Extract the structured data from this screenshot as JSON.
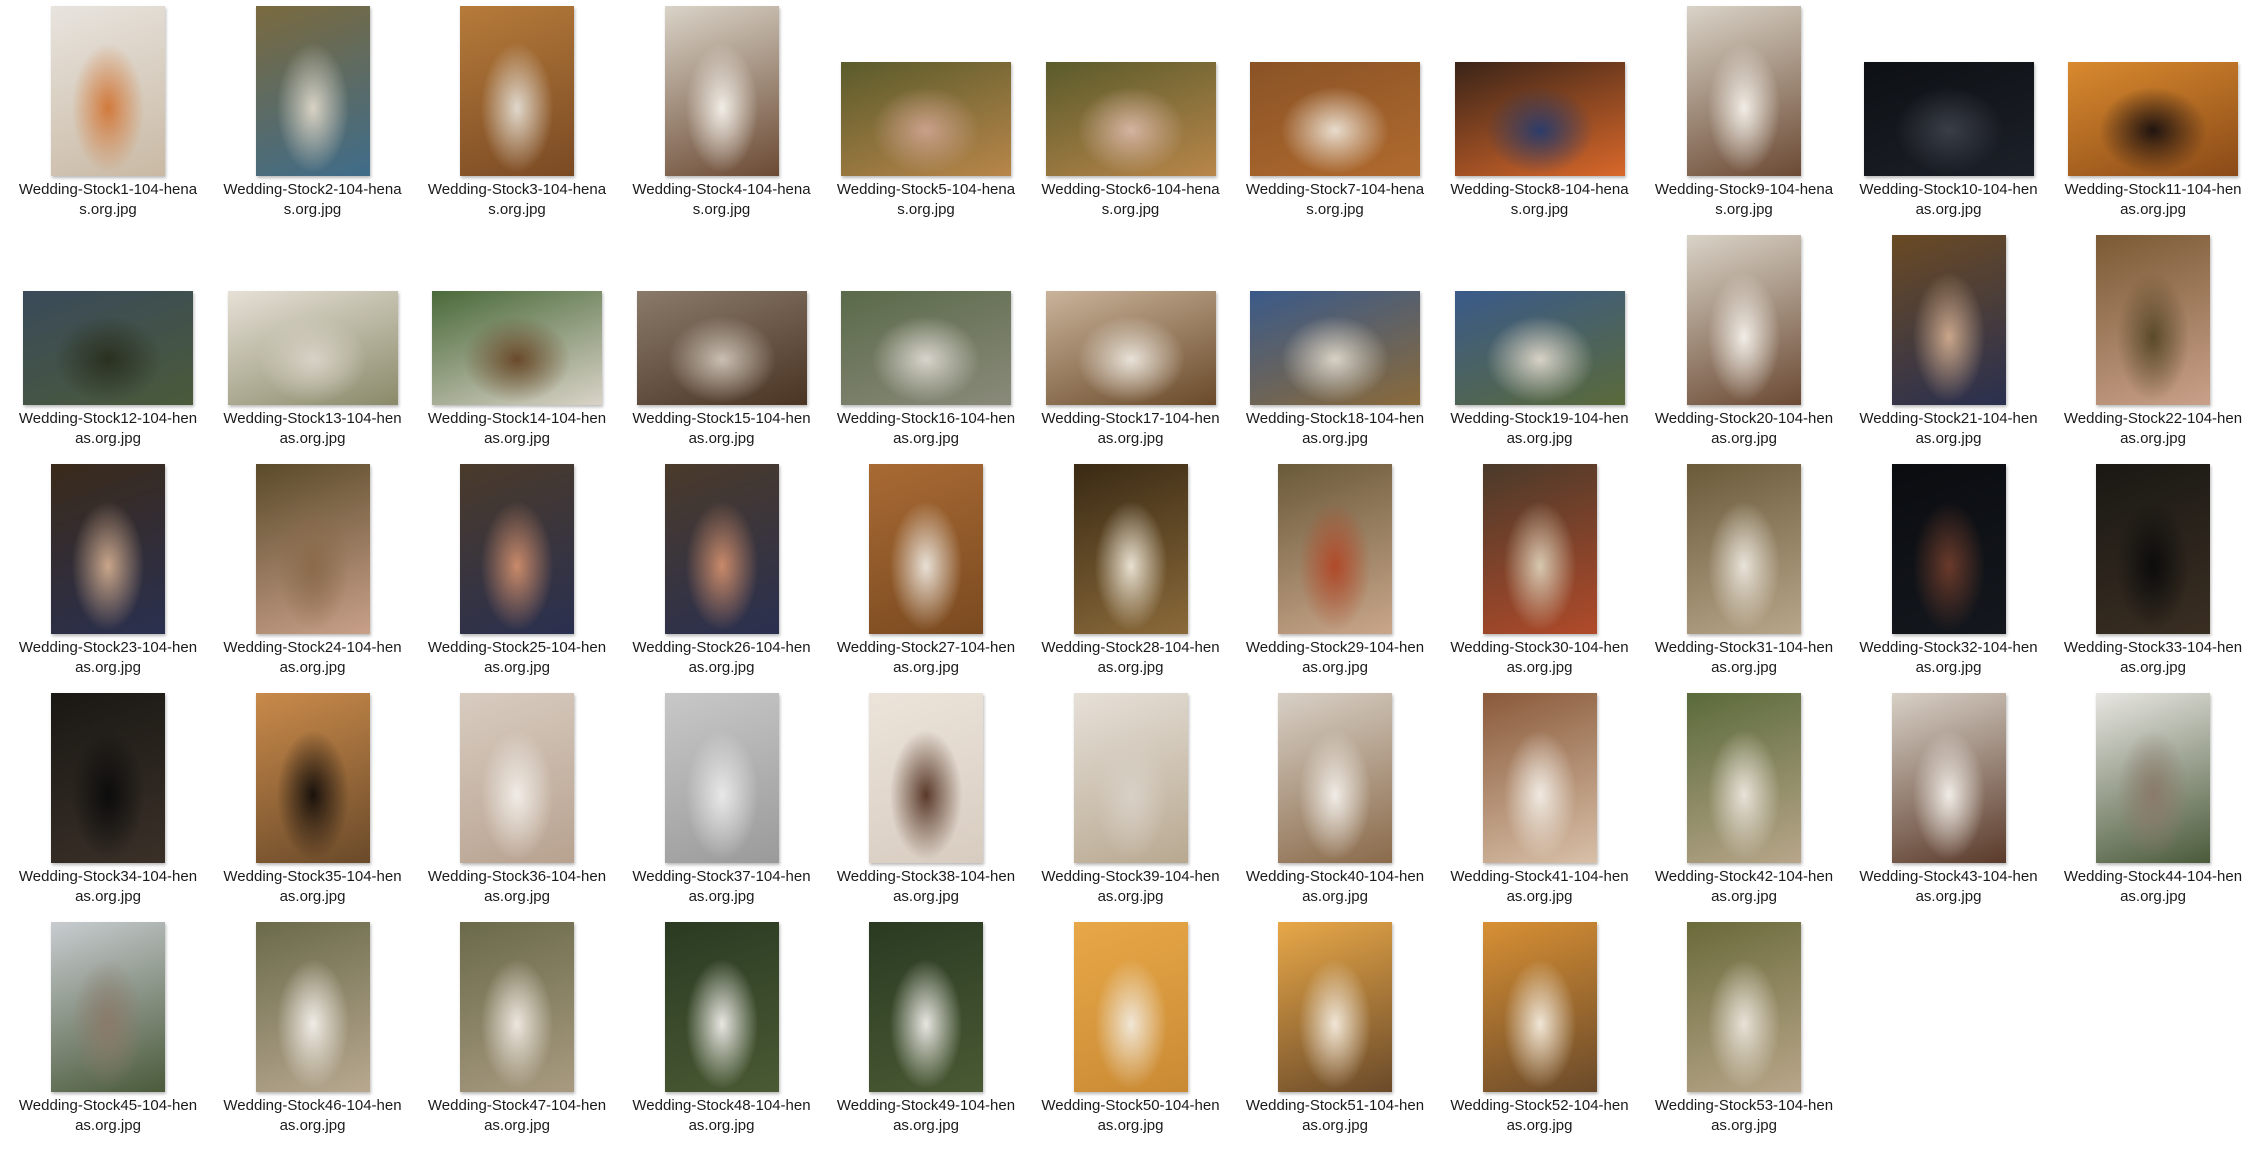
{
  "files": [
    {
      "l1": "Wedding-Stock1-104-hena",
      "l2": "s.org.jpg",
      "o": "p",
      "c": [
        "#e8e4de",
        "#c9b9a4",
        "#d27a3c"
      ]
    },
    {
      "l1": "Wedding-Stock2-104-hena",
      "l2": "s.org.jpg",
      "o": "p",
      "c": [
        "#7a6a3e",
        "#3f6c8a",
        "#d8d2c4"
      ]
    },
    {
      "l1": "Wedding-Stock3-104-hena",
      "l2": "s.org.jpg",
      "o": "p",
      "c": [
        "#b67b3a",
        "#7a4a24",
        "#e0d8cc"
      ]
    },
    {
      "l1": "Wedding-Stock4-104-hena",
      "l2": "s.org.jpg",
      "o": "p",
      "c": [
        "#d9d3c7",
        "#6b4a34",
        "#f1ede6"
      ]
    },
    {
      "l1": "Wedding-Stock5-104-hena",
      "l2": "s.org.jpg",
      "o": "l",
      "c": [
        "#5a5b2b",
        "#b8864a",
        "#c9a08a"
      ]
    },
    {
      "l1": "Wedding-Stock6-104-hena",
      "l2": "s.org.jpg",
      "o": "l",
      "c": [
        "#5a5b2b",
        "#b8864a",
        "#d4b3a0"
      ]
    },
    {
      "l1": "Wedding-Stock7-104-hena",
      "l2": "s.org.jpg",
      "o": "l",
      "c": [
        "#8a5326",
        "#b06a2e",
        "#e8dccd"
      ]
    },
    {
      "l1": "Wedding-Stock8-104-hena",
      "l2": "s.org.jpg",
      "o": "l",
      "c": [
        "#3a2418",
        "#d9682a",
        "#2c3c6a"
      ]
    },
    {
      "l1": "Wedding-Stock9-104-hena",
      "l2": "s.org.jpg",
      "o": "p",
      "c": [
        "#d9d3c7",
        "#6b4a34",
        "#f1ede6"
      ]
    },
    {
      "l1": "Wedding-Stock10-104-hen",
      "l2": "as.org.jpg",
      "o": "l",
      "c": [
        "#0d1014",
        "#1c2028",
        "#3a3e46"
      ]
    },
    {
      "l1": "Wedding-Stock11-104-hen",
      "l2": "as.org.jpg",
      "o": "l",
      "c": [
        "#d98a2e",
        "#8a4a18",
        "#201410"
      ]
    },
    {
      "l1": "Wedding-Stock12-104-hen",
      "l2": "as.org.jpg",
      "o": "l",
      "c": [
        "#3a4a5a",
        "#4a5a3a",
        "#2a3020"
      ]
    },
    {
      "l1": "Wedding-Stock13-104-hen",
      "l2": "as.org.jpg",
      "o": "l",
      "c": [
        "#e6e0d6",
        "#8a8a6a",
        "#d8d2c6"
      ]
    },
    {
      "l1": "Wedding-Stock14-104-hen",
      "l2": "as.org.jpg",
      "o": "l",
      "c": [
        "#4a6a3a",
        "#d9d3c7",
        "#6a4a2a"
      ]
    },
    {
      "l1": "Wedding-Stock15-104-hen",
      "l2": "as.org.jpg",
      "o": "l",
      "c": [
        "#8a7a6a",
        "#4a3424",
        "#c9bfb2"
      ]
    },
    {
      "l1": "Wedding-Stock16-104-hen",
      "l2": "as.org.jpg",
      "o": "l",
      "c": [
        "#5a6a4a",
        "#8a8a7a",
        "#d8d4cc"
      ]
    },
    {
      "l1": "Wedding-Stock17-104-hen",
      "l2": "as.org.jpg",
      "o": "l",
      "c": [
        "#c9b39a",
        "#6a4a2a",
        "#e8e2d8"
      ]
    },
    {
      "l1": "Wedding-Stock18-104-hen",
      "l2": "as.org.jpg",
      "o": "l",
      "c": [
        "#3a5a8a",
        "#8a6a3a",
        "#d8d2c6"
      ]
    },
    {
      "l1": "Wedding-Stock19-104-hen",
      "l2": "as.org.jpg",
      "o": "l",
      "c": [
        "#3a5a8a",
        "#5a6a3a",
        "#d8d2c6"
      ]
    },
    {
      "l1": "Wedding-Stock20-104-hen",
      "l2": "as.org.jpg",
      "o": "p",
      "c": [
        "#d9d3c7",
        "#6b4a34",
        "#f1ede6"
      ]
    },
    {
      "l1": "Wedding-Stock21-104-hen",
      "l2": "as.org.jpg",
      "o": "p",
      "c": [
        "#6a4a24",
        "#2a3050",
        "#c9a68a"
      ]
    },
    {
      "l1": "Wedding-Stock22-104-hen",
      "l2": "as.org.jpg",
      "o": "p",
      "c": [
        "#7a5a34",
        "#c9a08a",
        "#5a4a2a"
      ]
    },
    {
      "l1": "Wedding-Stock23-104-hen",
      "l2": "as.org.jpg",
      "o": "p",
      "c": [
        "#3a2a1a",
        "#2a3050",
        "#c9a68a"
      ]
    },
    {
      "l1": "Wedding-Stock24-104-hen",
      "l2": "as.org.jpg",
      "o": "p",
      "c": [
        "#5a4a2a",
        "#c9a08a",
        "#8a6a4a"
      ]
    },
    {
      "l1": "Wedding-Stock25-104-hen",
      "l2": "as.org.jpg",
      "o": "p",
      "c": [
        "#4a3a2a",
        "#2a3050",
        "#c98a6a"
      ]
    },
    {
      "l1": "Wedding-Stock26-104-hen",
      "l2": "as.org.jpg",
      "o": "p",
      "c": [
        "#4a3a2a",
        "#2a3050",
        "#c98a6a"
      ]
    },
    {
      "l1": "Wedding-Stock27-104-hen",
      "l2": "as.org.jpg",
      "o": "p",
      "c": [
        "#a86a34",
        "#7a4a20",
        "#e8e0d6"
      ]
    },
    {
      "l1": "Wedding-Stock28-104-hen",
      "l2": "as.org.jpg",
      "o": "p",
      "c": [
        "#3a2a14",
        "#8a6a3a",
        "#e8e0d0"
      ]
    },
    {
      "l1": "Wedding-Stock29-104-hen",
      "l2": "as.org.jpg",
      "o": "p",
      "c": [
        "#6a5a3a",
        "#c9a68a",
        "#b04a2a"
      ]
    },
    {
      "l1": "Wedding-Stock30-104-hen",
      "l2": "as.org.jpg",
      "o": "p",
      "c": [
        "#4a3a2a",
        "#b04a2a",
        "#d8c8b0"
      ]
    },
    {
      "l1": "Wedding-Stock31-104-hen",
      "l2": "as.org.jpg",
      "o": "p",
      "c": [
        "#6a5a3a",
        "#b8a68a",
        "#e8e2d8"
      ]
    },
    {
      "l1": "Wedding-Stock32-104-hen",
      "l2": "as.org.jpg",
      "o": "p",
      "c": [
        "#0a0c10",
        "#14181e",
        "#6a3a2a"
      ]
    },
    {
      "l1": "Wedding-Stock33-104-hen",
      "l2": "as.org.jpg",
      "o": "p",
      "c": [
        "#1a1814",
        "#3a2e22",
        "#0c0c0c"
      ]
    },
    {
      "l1": "Wedding-Stock34-104-hen",
      "l2": "as.org.jpg",
      "o": "p",
      "c": [
        "#1a1814",
        "#3a3028",
        "#0c0c0c"
      ]
    },
    {
      "l1": "Wedding-Stock35-104-hen",
      "l2": "as.org.jpg",
      "o": "p",
      "c": [
        "#c98a4a",
        "#6a4a2a",
        "#1a120c"
      ]
    },
    {
      "l1": "Wedding-Stock36-104-hen",
      "l2": "as.org.jpg",
      "o": "p",
      "c": [
        "#d8ccc0",
        "#b8a290",
        "#f0ece6"
      ]
    },
    {
      "l1": "Wedding-Stock37-104-hen",
      "l2": "as.org.jpg",
      "o": "p",
      "c": [
        "#c8c8c8",
        "#9a9a9a",
        "#e8e8e8"
      ]
    },
    {
      "l1": "Wedding-Stock38-104-hen",
      "l2": "as.org.jpg",
      "o": "p",
      "c": [
        "#ece4da",
        "#d8ccc0",
        "#5a3a2a"
      ]
    },
    {
      "l1": "Wedding-Stock39-104-hen",
      "l2": "as.org.jpg",
      "o": "p",
      "c": [
        "#e6e0d8",
        "#b8a890",
        "#d8d0c6"
      ]
    },
    {
      "l1": "Wedding-Stock40-104-hen",
      "l2": "as.org.jpg",
      "o": "p",
      "c": [
        "#d8d0c6",
        "#8a6a4a",
        "#f0ece6"
      ]
    },
    {
      "l1": "Wedding-Stock41-104-hen",
      "l2": "as.org.jpg",
      "o": "p",
      "c": [
        "#8a5a3a",
        "#d8c0a8",
        "#f0eae2"
      ]
    },
    {
      "l1": "Wedding-Stock42-104-hen",
      "l2": "as.org.jpg",
      "o": "p",
      "c": [
        "#5a6a3a",
        "#b8a68a",
        "#e8e2d8"
      ]
    },
    {
      "l1": "Wedding-Stock43-104-hen",
      "l2": "as.org.jpg",
      "o": "p",
      "c": [
        "#d8d0c6",
        "#5a3a2a",
        "#f0ece6"
      ]
    },
    {
      "l1": "Wedding-Stock44-104-hen",
      "l2": "as.org.jpg",
      "o": "p",
      "c": [
        "#e8e6e2",
        "#4a5a3a",
        "#8a7a6a"
      ]
    },
    {
      "l1": "Wedding-Stock45-104-hen",
      "l2": "as.org.jpg",
      "o": "p",
      "c": [
        "#c8ccd0",
        "#4a5a3a",
        "#8a7a6a"
      ]
    },
    {
      "l1": "Wedding-Stock46-104-hen",
      "l2": "as.org.jpg",
      "o": "p",
      "c": [
        "#6a6a4a",
        "#b8a890",
        "#f0ece6"
      ]
    },
    {
      "l1": "Wedding-Stock47-104-hen",
      "l2": "as.org.jpg",
      "o": "p",
      "c": [
        "#6a6a4a",
        "#a89a80",
        "#ece6de"
      ]
    },
    {
      "l1": "Wedding-Stock48-104-hen",
      "l2": "as.org.jpg",
      "o": "p",
      "c": [
        "#2a3a22",
        "#4a5a34",
        "#e8e6e2"
      ]
    },
    {
      "l1": "Wedding-Stock49-104-hen",
      "l2": "as.org.jpg",
      "o": "p",
      "c": [
        "#2a3a22",
        "#4a5a34",
        "#e8e6e2"
      ]
    },
    {
      "l1": "Wedding-Stock50-104-hen",
      "l2": "as.org.jpg",
      "o": "p",
      "c": [
        "#e8a848",
        "#c98a34",
        "#f0e6d6"
      ]
    },
    {
      "l1": "Wedding-Stock51-104-hen",
      "l2": "as.org.jpg",
      "o": "p",
      "c": [
        "#e8a848",
        "#6a4a2a",
        "#f0e6d6"
      ]
    },
    {
      "l1": "Wedding-Stock52-104-hen",
      "l2": "as.org.jpg",
      "o": "p",
      "c": [
        "#d89034",
        "#6a4a2a",
        "#f0e6d6"
      ]
    },
    {
      "l1": "Wedding-Stock53-104-hen",
      "l2": "as.org.jpg",
      "o": "p",
      "c": [
        "#6a6a3a",
        "#b8a68a",
        "#e8e2d8"
      ]
    }
  ]
}
